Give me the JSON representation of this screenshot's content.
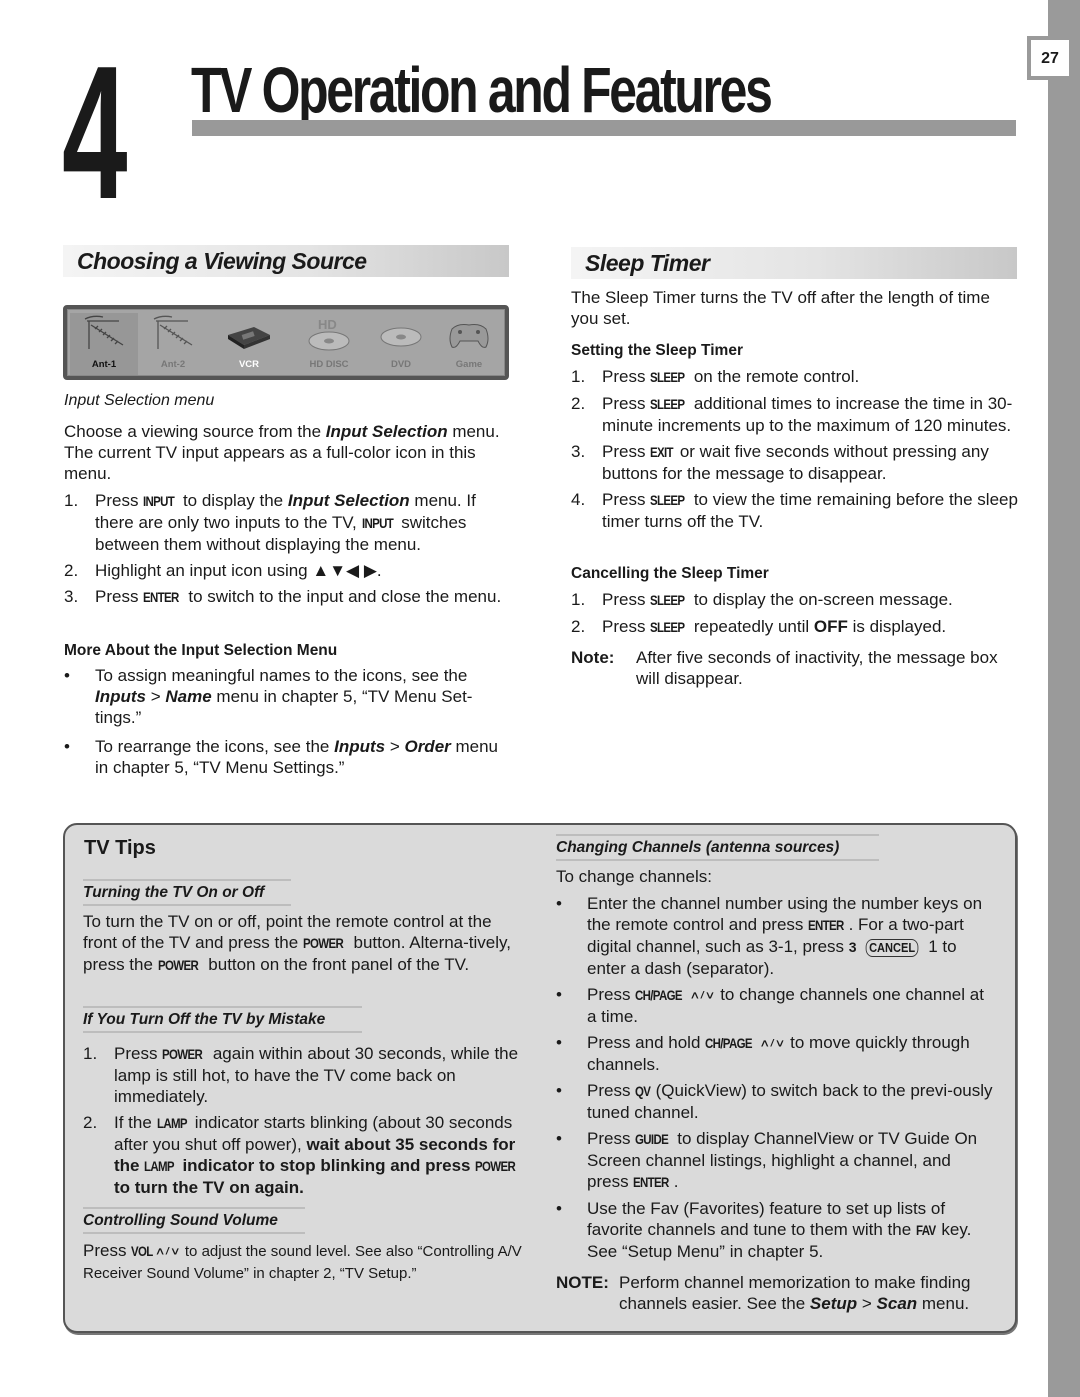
{
  "page": {
    "number": "27",
    "chapter_number": "4",
    "chapter_title": "TV Operation and Features"
  },
  "viewing_source": {
    "heading": "Choosing a Viewing Source",
    "menu_items": [
      {
        "label": "Ant-1",
        "icon": "antenna-icon",
        "state": "highlighted"
      },
      {
        "label": "Ant-2",
        "icon": "antenna-icon",
        "state": "dim"
      },
      {
        "label": "VCR",
        "icon": "vcr-icon",
        "state": "current"
      },
      {
        "label": "HD DISC",
        "icon": "hd-disc-icon",
        "state": "dim"
      },
      {
        "label": "DVD",
        "icon": "dvd-disc-icon",
        "state": "dim"
      },
      {
        "label": "Game",
        "icon": "gamepad-icon",
        "state": "dim"
      }
    ],
    "caption": "Input Selection menu",
    "intro": [
      "Choose a viewing source from the ",
      "Input Selection",
      " menu.  The current TV input appears as a full-color icon in this menu."
    ],
    "steps": [
      {
        "n": "1.",
        "parts": [
          "Press ",
          "INPUT",
          " to display the ",
          "Input Selection",
          " menu.  If there are only two inputs to the TV, ",
          "INPUT",
          " switches between them without displaying the menu."
        ]
      },
      {
        "n": "2.",
        "parts": [
          "Highlight an input icon using ",
          "▲▼◀ ▶",
          "."
        ]
      },
      {
        "n": "3.",
        "parts": [
          "Press ",
          "ENTER",
          " to switch to the input and close the menu."
        ]
      }
    ],
    "more_heading": "More About the Input Selection Menu",
    "more_bullets": [
      {
        "parts": [
          "To assign meaningful names to the icons, see the ",
          "Inputs",
          " > ",
          "Name",
          " menu in chapter 5, “TV Menu Set-tings.”"
        ]
      },
      {
        "parts": [
          "To rearrange the icons, see the ",
          "Inputs",
          " > ",
          "Order",
          " menu in chapter 5, “TV Menu Settings.”"
        ]
      }
    ]
  },
  "sleep_timer": {
    "heading": "Sleep Timer",
    "intro": "The Sleep Timer turns the TV off after the length of time you set.",
    "setting_heading": "Setting the Sleep Timer",
    "setting_steps": [
      {
        "n": "1.",
        "parts": [
          "Press ",
          "SLEEP",
          " on the remote control."
        ]
      },
      {
        "n": "2.",
        "parts": [
          "Press ",
          "SLEEP",
          " additional times to increase the time in 30-minute increments up to the maximum of 120 minutes."
        ]
      },
      {
        "n": "3.",
        "parts": [
          "Press ",
          "EXIT",
          " or wait five seconds without pressing any buttons for the message to disappear."
        ]
      },
      {
        "n": "4.",
        "parts": [
          "Press ",
          "SLEEP",
          " to view the time remaining before the sleep timer turns off the TV."
        ]
      }
    ],
    "cancel_heading": "Cancelling the Sleep Timer",
    "cancel_steps": [
      {
        "n": "1.",
        "parts": [
          "Press ",
          "SLEEP",
          " to display the on-screen message."
        ]
      },
      {
        "n": "2.",
        "parts": [
          "Press ",
          "SLEEP",
          " repeatedly until ",
          "OFF",
          " is displayed."
        ]
      }
    ],
    "note_label": "Note:",
    "note_text": "After five seconds of inactivity, the message box will disappear."
  },
  "tv_tips": {
    "title": "TV Tips",
    "turning_heading": "Turning the TV On or Off",
    "turning_parts": [
      "To turn the TV on or off, point the remote control at the front of the TV and press the ",
      "POWER",
      " button.  Alterna-tively, press the ",
      "POWER",
      " button on the front panel of the TV."
    ],
    "mistake_heading": "If You Turn Off the TV by Mistake",
    "mistake_steps": [
      {
        "n": "1.",
        "parts": [
          "Press ",
          "POWER",
          " again within about 30 seconds, while the lamp is still hot, to have the TV come back on immediately."
        ]
      },
      {
        "n": "2.",
        "parts": [
          "If the ",
          "LAMP",
          " indicator starts blinking (about 30 seconds after you shut off power), ",
          "wait about 35 seconds for the ",
          "LAMP",
          " indicator to stop blinking and press ",
          "POWER",
          " to turn the TV on again."
        ]
      }
    ],
    "volume_heading": "Controlling Sound Volume",
    "volume_parts": [
      "Press ",
      "VOL",
      " ∧/∨",
      " to adjust the sound level.  See also “Controlling A/V Receiver Sound Volume” in chapter 2, “TV Setup.”"
    ],
    "channels_heading": "Changing Channels (antenna sources)",
    "channels_intro": "To change channels:",
    "channel_bullets": [
      {
        "parts": [
          "Enter the channel number using the number keys on the remote control and press ",
          "ENTER",
          ".  For a two-part digital channel, such as 3-1, press ",
          "3",
          "CANCEL",
          "1",
          " to enter a dash (separator)."
        ]
      },
      {
        "parts": [
          "Press ",
          "CH/PAGE",
          " ∧/∨",
          " to change channels one channel at a time."
        ]
      },
      {
        "parts": [
          "Press and hold ",
          "CH/PAGE",
          " ∧/∨",
          " to move quickly through channels."
        ]
      },
      {
        "parts": [
          "Press ",
          "QV",
          " (QuickView) to switch back to the previ-ously tuned channel."
        ]
      },
      {
        "parts": [
          "Press ",
          "GUIDE",
          " to display ChannelView or TV Guide On Screen channel listings, highlight a channel, and press ",
          "ENTER",
          "."
        ]
      },
      {
        "parts": [
          "Use the Fav (Favorites) feature to set up lists of favorite channels and tune to them with the ",
          "FAV",
          " key. See “Setup Menu” in chapter 5."
        ]
      }
    ],
    "note_label": "NOTE:",
    "note_parts": [
      "Perform channel memorization to make finding channels easier.  See the ",
      "Setup",
      " > ",
      "Scan",
      " menu."
    ]
  }
}
